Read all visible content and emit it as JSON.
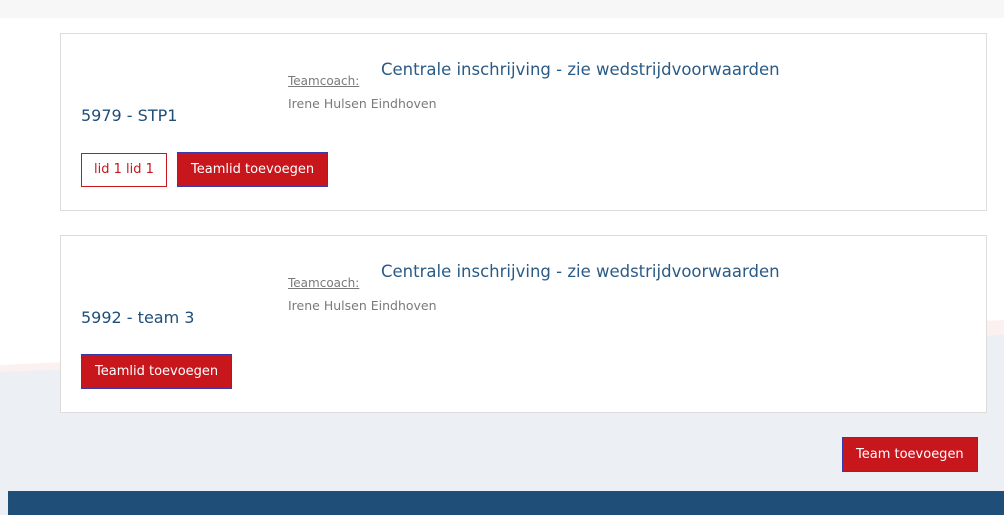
{
  "teams": [
    {
      "name": "5979 - STP1",
      "coach_label": "Teamcoach:",
      "event_title": "Centrale inschrijving - zie wedstrijdvoorwaarden",
      "coach_name": "Irene Hulsen Eindhoven",
      "member": "lid 1 lid 1",
      "add_member_label": "Teamlid toevoegen"
    },
    {
      "name": "5992 - team 3",
      "coach_label": "Teamcoach:",
      "event_title": "Centrale inschrijving - zie wedstrijdvoorwaarden",
      "coach_name": "Irene Hulsen Eindhoven",
      "add_member_label": "Teamlid toevoegen"
    }
  ],
  "add_team_label": "Team toevoegen",
  "colors": {
    "primary_red": "#c8161d",
    "team_title_blue": "#1f4e79",
    "footer_blue": "#1f4e79",
    "muted_text": "#7a7a7a"
  }
}
